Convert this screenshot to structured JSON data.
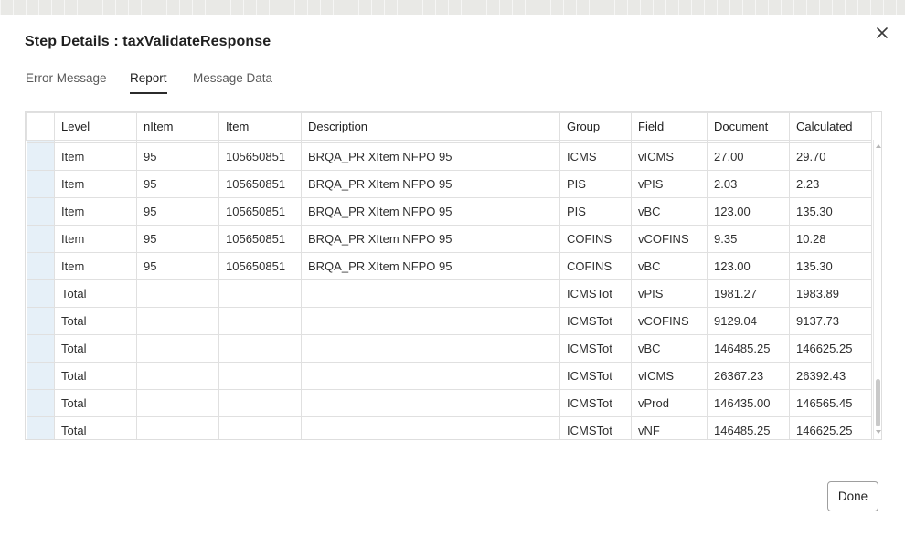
{
  "dialog": {
    "title": "Step Details : taxValidateResponse",
    "close_icon": "close-icon"
  },
  "tabs": [
    {
      "label": "Error Message",
      "active": false
    },
    {
      "label": "Report",
      "active": true
    },
    {
      "label": "Message Data",
      "active": false
    }
  ],
  "table": {
    "columns": [
      "Level",
      "nItem",
      "Item",
      "Description",
      "Group",
      "Field",
      "Document",
      "Calculated"
    ],
    "rows": [
      [
        "Item",
        "95",
        "105650851",
        "BRQA_PR XItem NFPO 95",
        "ICMS",
        "vICMS",
        "27.00",
        "29.70"
      ],
      [
        "Item",
        "95",
        "105650851",
        "BRQA_PR XItem NFPO 95",
        "PIS",
        "vPIS",
        "2.03",
        "2.23"
      ],
      [
        "Item",
        "95",
        "105650851",
        "BRQA_PR XItem NFPO 95",
        "PIS",
        "vBC",
        "123.00",
        "135.30"
      ],
      [
        "Item",
        "95",
        "105650851",
        "BRQA_PR XItem NFPO 95",
        "COFINS",
        "vCOFINS",
        "9.35",
        "10.28"
      ],
      [
        "Item",
        "95",
        "105650851",
        "BRQA_PR XItem NFPO 95",
        "COFINS",
        "vBC",
        "123.00",
        "135.30"
      ],
      [
        "Total",
        "",
        "",
        "",
        "ICMSTot",
        "vPIS",
        "1981.27",
        "1983.89"
      ],
      [
        "Total",
        "",
        "",
        "",
        "ICMSTot",
        "vCOFINS",
        "9129.04",
        "9137.73"
      ],
      [
        "Total",
        "",
        "",
        "",
        "ICMSTot",
        "vBC",
        "146485.25",
        "146625.25"
      ],
      [
        "Total",
        "",
        "",
        "",
        "ICMSTot",
        "vICMS",
        "26367.23",
        "26392.43"
      ],
      [
        "Total",
        "",
        "",
        "",
        "ICMSTot",
        "vProd",
        "146435.00",
        "146565.45"
      ],
      [
        "Total",
        "",
        "",
        "",
        "ICMSTot",
        "vNF",
        "146485.25",
        "146625.25"
      ]
    ]
  },
  "footer": {
    "done_label": "Done"
  }
}
